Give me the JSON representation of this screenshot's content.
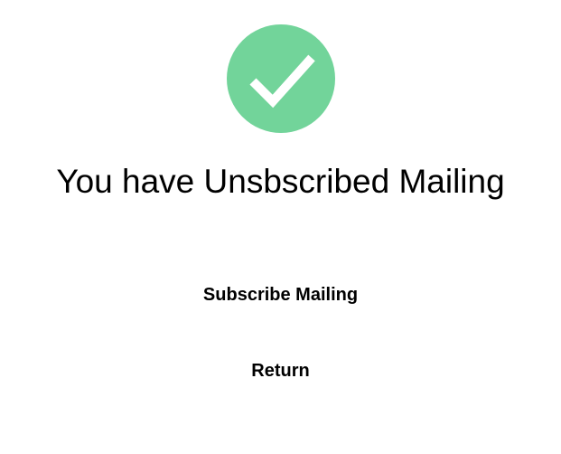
{
  "status": {
    "icon": "checkmark-icon",
    "icon_color": "#72d49a",
    "message": "You have Unsbscribed Mailing"
  },
  "actions": {
    "subscribe_label": "Subscribe Mailing",
    "return_label": "Return"
  }
}
